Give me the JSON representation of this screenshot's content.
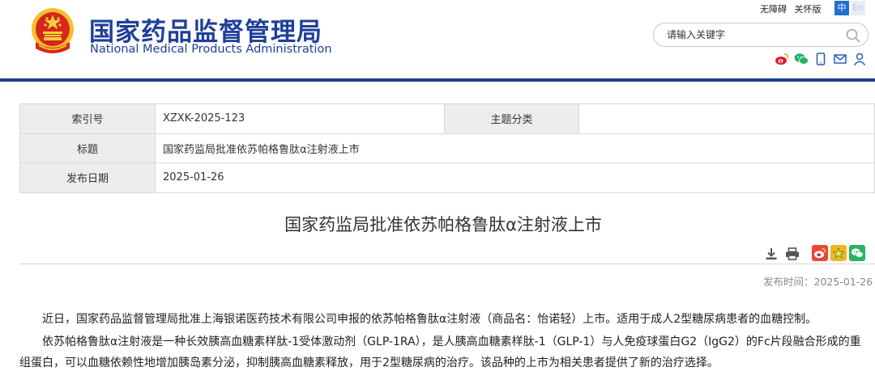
{
  "header": {
    "title_cn": "国家药品监督管理局",
    "title_en": "National Medical Products Administration",
    "accessibility_label": "无障碍",
    "legacy_label": "关怀版",
    "lang_zh": "中",
    "lang_en": "En"
  },
  "search": {
    "placeholder": "请输入关键字"
  },
  "social_icons": [
    "weibo-icon",
    "wechat-icon",
    "mobile-icon",
    "mail-icon",
    "user-icon"
  ],
  "info": {
    "index_label": "索引号",
    "index_value": "XZXK-2025-123",
    "category_label": "主题分类",
    "category_value": "",
    "title_label": "标题",
    "title_value": "国家药监局批准依苏帕格鲁肽α注射液上市",
    "date_label": "发布日期",
    "date_value": "2025-01-26"
  },
  "article": {
    "title": "国家药监局批准依苏帕格鲁肽α注射液上市",
    "pubtime": "发布时间：2025-01-26",
    "paragraphs": [
      "近日，国家药品监督管理局批准上海银诺医药技术有限公司申报的依苏帕格鲁肽α注射液（商品名：怡诺轻）上市。适用于成人2型糖尿病患者的血糖控制。",
      "依苏帕格鲁肽α注射液是一种长效胰高血糖素样肽-1受体激动剂（GLP-1RA），是人胰高血糖素样肽-1（GLP-1）与人免疫球蛋白G2（IgG2）的Fc片段融合形成的重组蛋白，可以血糖依赖性地增加胰岛素分泌，抑制胰高血糖素释放，用于2型糖尿病的治疗。该品种的上市为相关患者提供了新的治疗选择。"
    ]
  },
  "colors": {
    "brand_blue": "#1f3f9a",
    "header_bar": "#1d3f92",
    "table_label_bg": "#ededed"
  }
}
